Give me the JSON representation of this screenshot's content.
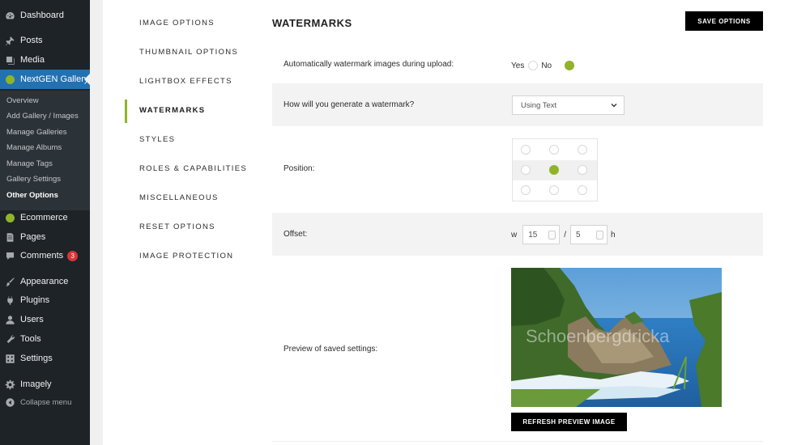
{
  "sidebar": {
    "items": [
      {
        "label": "Dashboard",
        "icon": "dashboard-icon"
      },
      {
        "label": "Posts",
        "icon": "pin-icon"
      },
      {
        "label": "Media",
        "icon": "media-icon"
      },
      {
        "label": "NextGEN Gallery",
        "icon": "nextgen-icon"
      },
      {
        "label": "Ecommerce",
        "icon": "nextgen-icon"
      },
      {
        "label": "Pages",
        "icon": "page-icon"
      },
      {
        "label": "Comments",
        "icon": "comment-icon",
        "badge": "3"
      },
      {
        "label": "Appearance",
        "icon": "brush-icon"
      },
      {
        "label": "Plugins",
        "icon": "plug-icon"
      },
      {
        "label": "Users",
        "icon": "user-icon"
      },
      {
        "label": "Tools",
        "icon": "wrench-icon"
      },
      {
        "label": "Settings",
        "icon": "settings-icon"
      },
      {
        "label": "Imagely",
        "icon": "gear-icon"
      }
    ],
    "submenu": [
      "Overview",
      "Add Gallery / Images",
      "Manage Galleries",
      "Manage Albums",
      "Manage Tags",
      "Gallery Settings",
      "Other Options"
    ],
    "collapse_label": "Collapse menu",
    "accent_color": "#2271b1"
  },
  "tabs": [
    "IMAGE OPTIONS",
    "THUMBNAIL OPTIONS",
    "LIGHTBOX EFFECTS",
    "WATERMARKS",
    "STYLES",
    "ROLES & CAPABILITIES",
    "MISCELLANEOUS",
    "RESET OPTIONS",
    "IMAGE PROTECTION"
  ],
  "active_tab": "WATERMARKS",
  "page": {
    "title": "WATERMARKS",
    "save_label": "SAVE OPTIONS"
  },
  "settings": {
    "auto_label": "Automatically watermark images during upload:",
    "yes_label": "Yes",
    "no_label": "No",
    "auto_value": "No",
    "generate_label": "How will you generate a watermark?",
    "generate_value": "Using Text",
    "position_label": "Position:",
    "position_value": "middle-center",
    "offset_label": "Offset:",
    "offset_w_label": "w",
    "offset_w": "15",
    "offset_sep": "/",
    "offset_h": "5",
    "offset_h_label": "h",
    "preview_label": "Preview of saved settings:",
    "watermark_text": "Schoenbergdricka",
    "refresh_label": "REFRESH PREVIEW IMAGE"
  },
  "colors": {
    "green": "#8fb429",
    "black": "#000000"
  }
}
